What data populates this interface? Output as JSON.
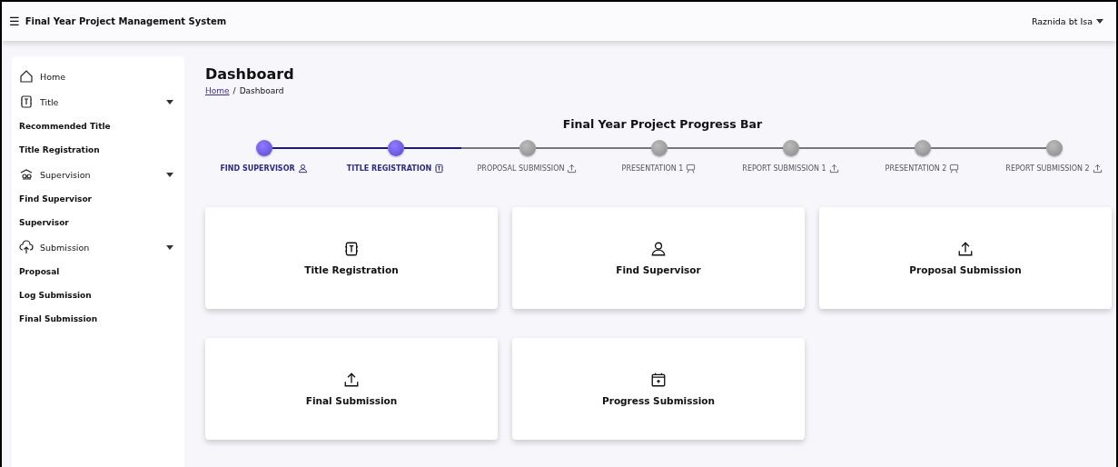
{
  "header": {
    "menu_icon": "☰",
    "title": "Final Year Project Management System",
    "user": "Raznida bt Isa"
  },
  "sidebar": {
    "items": [
      {
        "kind": "home",
        "label": "Home"
      },
      {
        "kind": "title",
        "label": "Title"
      },
      {
        "kind": "link",
        "label": "Recommended Title"
      },
      {
        "kind": "link",
        "label": "Title Registration"
      },
      {
        "kind": "supervision",
        "label": "Supervision"
      },
      {
        "kind": "link",
        "label": "Find Supervisor"
      },
      {
        "kind": "link",
        "label": "Supervisor"
      },
      {
        "kind": "submission",
        "label": "Submission"
      },
      {
        "kind": "link",
        "label": "Proposal"
      },
      {
        "kind": "link",
        "label": "Log Submission"
      },
      {
        "kind": "link",
        "label": "Final Submission"
      }
    ]
  },
  "page": {
    "title": "Dashboard",
    "breadcrumb": {
      "link": "Home",
      "separator": "/",
      "current": "Dashboard"
    }
  },
  "progress": {
    "title": "Final Year Project Progress Bar",
    "steps": [
      {
        "label": "FIND SUPERVISOR",
        "kind": "user",
        "done": true
      },
      {
        "label": "TITLE REGISTRATION",
        "kind": "title",
        "done": true
      },
      {
        "label": "PROPOSAL SUBMISSION",
        "kind": "upload",
        "done": false
      },
      {
        "label": "PRESENTATION 1",
        "kind": "presentation",
        "done": false
      },
      {
        "label": "REPORT SUBMISSION 1",
        "kind": "upload",
        "done": false
      },
      {
        "label": "PRESENTATION 2",
        "kind": "presentation",
        "done": false
      },
      {
        "label": "REPORT SUBMISSION 2",
        "kind": "upload",
        "done": false
      }
    ]
  },
  "cards": [
    {
      "kind": "title",
      "label": "Title Registration"
    },
    {
      "kind": "user",
      "label": "Find Supervisor"
    },
    {
      "kind": "upload",
      "label": "Proposal Submission"
    },
    {
      "kind": "upload",
      "label": "Final Submission"
    },
    {
      "kind": "calendar",
      "label": "Progress Submission"
    }
  ]
}
